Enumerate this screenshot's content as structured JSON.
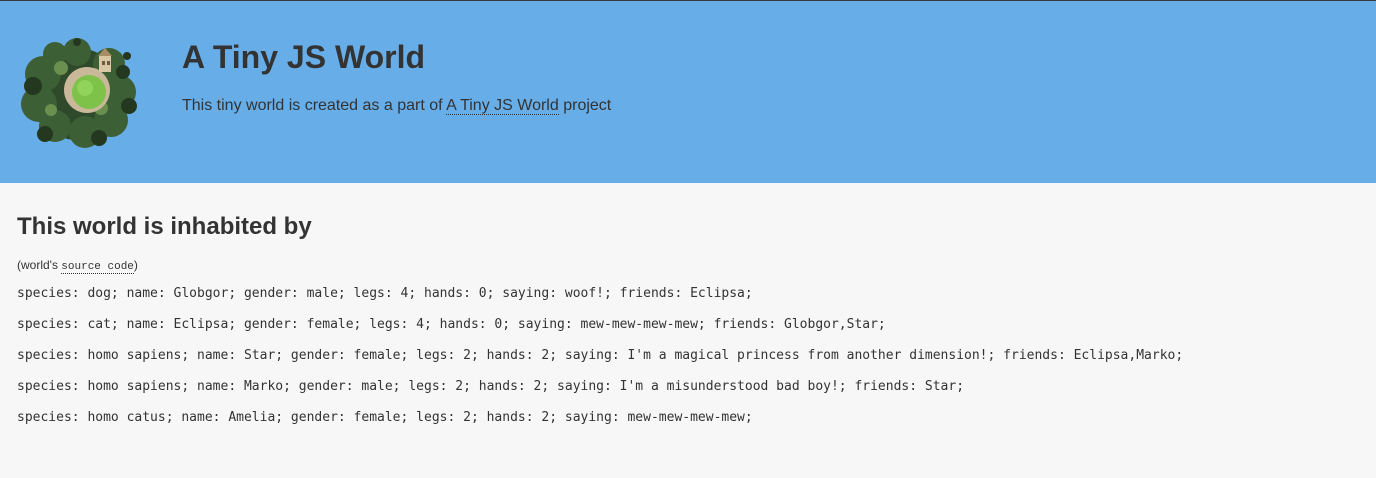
{
  "header": {
    "title": "A Tiny JS World",
    "subtitle_prefix": "This tiny world is created as a part of ",
    "subtitle_link": "A Tiny JS World",
    "subtitle_suffix": " project",
    "logo_icon": "tiny-planet-icon"
  },
  "main": {
    "heading": "This world is inhabited by",
    "source_prefix": "(world's ",
    "source_link": "source code",
    "source_suffix": ")",
    "inhabitants": [
      "species: dog; name: Globgor; gender: male; legs: 4; hands: 0; saying: woof!; friends: Eclipsa;",
      "species: cat; name: Eclipsa; gender: female; legs: 4; hands: 0; saying: mew-mew-mew-mew; friends: Globgor,Star;",
      "species: homo sapiens; name: Star; gender: female; legs: 2; hands: 2; saying: I'm a magical princess from another dimension!; friends: Eclipsa,Marko;",
      "species: homo sapiens; name: Marko; gender: male; legs: 2; hands: 2; saying: I'm a misunderstood bad boy!; friends: Star;",
      "species: homo catus; name: Amelia; gender: female; legs: 2; hands: 2; saying: mew-mew-mew-mew;"
    ]
  },
  "colors": {
    "header_bg": "#67ade8",
    "page_bg": "#f7f7f7",
    "text": "#333333"
  }
}
